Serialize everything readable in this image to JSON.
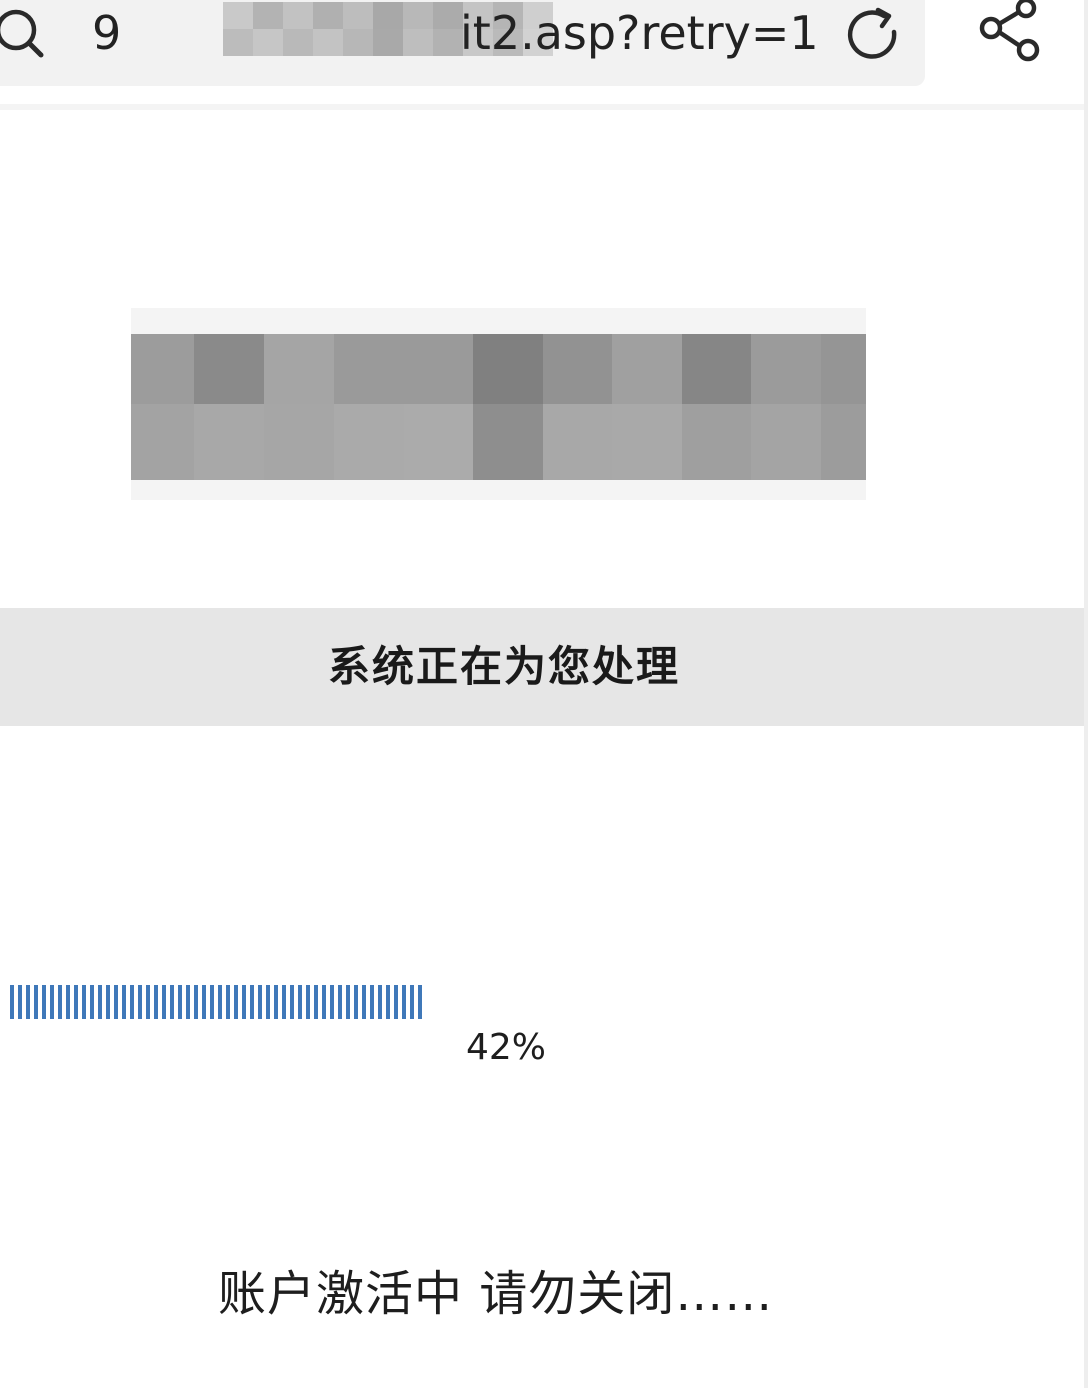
{
  "address_bar": {
    "url_prefix": "9",
    "url_suffix": "it2.asp?retry=1",
    "icons": {
      "search": "search-icon",
      "reload": "reload-icon",
      "share": "share-icon"
    }
  },
  "processing": {
    "message": "系统正在为您处理"
  },
  "progress": {
    "value": 0.42,
    "label": "42%",
    "fill_color": "#3f78b9"
  },
  "activation": {
    "message": "账户激活中 请勿关闭……"
  },
  "colors": {
    "banner_background": "#e6e6e6",
    "address_bar_background": "#f2f2f2"
  }
}
